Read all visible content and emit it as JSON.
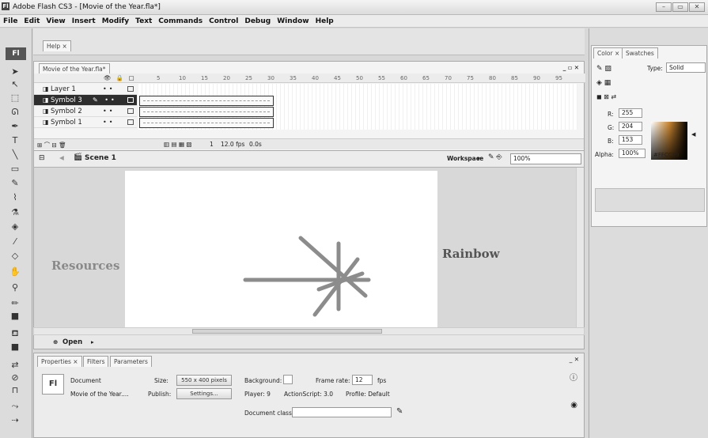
{
  "window": {
    "title": "Adobe Flash CS3 - [Movie of the Year.fla*]",
    "app_badge": "Fl",
    "minimize": "–",
    "restore": "▭",
    "close": "✕"
  },
  "menu": [
    "File",
    "Edit",
    "View",
    "Insert",
    "Modify",
    "Text",
    "Commands",
    "Control",
    "Debug",
    "Window",
    "Help"
  ],
  "help_tab": "Help ×",
  "document_tab": "Movie of the Year.fla*",
  "timeline": {
    "frame_numbers": [
      "5",
      "10",
      "15",
      "20",
      "25",
      "30",
      "35",
      "40",
      "45",
      "50",
      "55",
      "60",
      "65",
      "70",
      "75",
      "80",
      "85",
      "90",
      "95"
    ],
    "layers": [
      {
        "name": "Layer 1",
        "selected": false
      },
      {
        "name": "Symbol 3",
        "selected": true
      },
      {
        "name": "Symbol 2",
        "selected": false
      },
      {
        "name": "Symbol 1",
        "selected": false
      }
    ],
    "current_frame": "1",
    "fps": "12.0 fps",
    "time": "0.0s"
  },
  "scene": {
    "name": "Scene 1",
    "workspace": "Workspace",
    "zoom": "100%"
  },
  "stage": {
    "resources_text": "Resources",
    "rainbow_text": "Rainbow",
    "open_label": "Open"
  },
  "properties": {
    "tabs": [
      "Properties ×",
      "Filters",
      "Parameters"
    ],
    "doc_type": "Document",
    "doc_name": "Movie of the Year....",
    "size_label": "Size:",
    "size_value": "550 x 400 pixels",
    "publish_label": "Publish:",
    "settings_btn": "Settings...",
    "background_label": "Background:",
    "framerate_label": "Frame rate:",
    "framerate_value": "12",
    "fps_unit": "fps",
    "player": "Player: 9",
    "actionscript": "ActionScript: 3.0",
    "profile": "Profile: Default",
    "docclass_label": "Document class:",
    "docclass_value": ""
  },
  "color": {
    "tabs": [
      "Color ×",
      "Swatches"
    ],
    "type_label": "Type:",
    "type_value": "Solid",
    "r_label": "R:",
    "r_value": "255",
    "g_label": "G:",
    "g_value": "204",
    "b_label": "B:",
    "b_value": "153",
    "alpha_label": "Alpha:",
    "alpha_value": "100%",
    "hex_value": "#FFCC99"
  },
  "colors": {
    "selected_layer_bg": "#2e2e2e",
    "stage_bg": "#ffffff",
    "star_stroke": "#8c8c8c"
  }
}
